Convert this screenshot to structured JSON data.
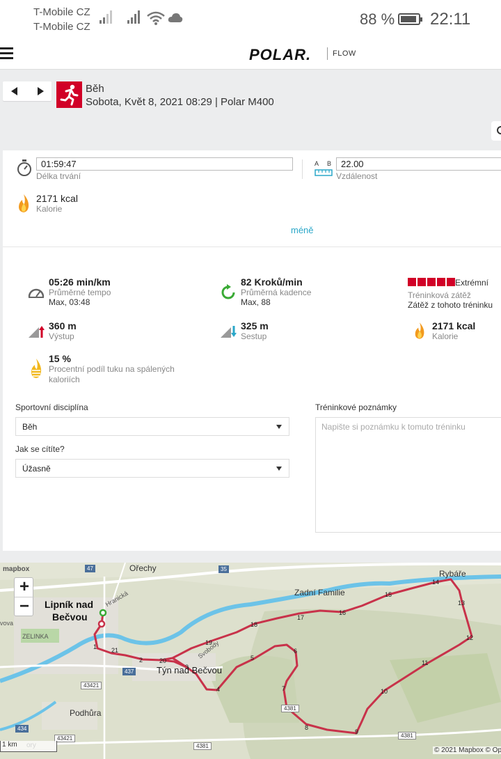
{
  "status_bar": {
    "carrier_1": "T-Mobile CZ",
    "carrier_2": "T-Mobile CZ",
    "battery": "88 %",
    "time": "22:11"
  },
  "app": {
    "brand": "POLAR.",
    "brand_sub": "FLOW"
  },
  "session": {
    "sport": "Běh",
    "details": "Sobota, Květ 8, 2021 08:29 | Polar M400",
    "sport_color": "#d10027"
  },
  "summary": {
    "duration_value": "01:59:47",
    "duration_label": "Délka trvání",
    "ab_label_a": "A",
    "ab_label_b": "B",
    "distance_value": "22.00",
    "distance_label": "Vzdálenost",
    "calories_value": "2171 kcal",
    "calories_label": "Kalorie",
    "less_link": "méně"
  },
  "stats": {
    "pace_value": "05:26 min/km",
    "pace_label": "Průměrné tempo",
    "pace_max": "Max, 03:48",
    "cadence_value": "82 Kroků/min",
    "cadence_label": "Průměrná kadence",
    "cadence_max": "Max, 88",
    "load_value": "Extrémní",
    "load_label": "Tréninková zátěž",
    "load_sub": "Zátěž z tohoto tréninku",
    "load_level": 5,
    "ascent_value": "360 m",
    "ascent_label": "Výstup",
    "descent_value": "325 m",
    "descent_label": "Sestup",
    "calories2_value": "2171 kcal",
    "calories2_label": "Kalorie",
    "fat_value": "15 %",
    "fat_label": "Procentní podíl tuku na spálených kaloriích"
  },
  "form": {
    "sport_label": "Sportovní disciplína",
    "sport_value": "Běh",
    "feeling_label": "Jak se cítíte?",
    "feeling_value": "Úžasně",
    "notes_label": "Tréninkové poznámky",
    "notes_placeholder": "Napište si poznámku k tomuto tréninku"
  },
  "map": {
    "logo": "mapbox",
    "attribution": "© 2021 Mapbox © Op",
    "scale": "1 km",
    "places": {
      "lipnik_1": "Lipník nad",
      "lipnik_2": "Bečvou",
      "orechy": "Ořechy",
      "zadni": "Zadní Familie",
      "rybare": "Rybáře",
      "tyn": "Týn nad Bečvou",
      "podhura": "Podhůra",
      "zelinka": "ZELINKA",
      "hranicka": "Hranická",
      "svobody": "Svobody",
      "vova": "vova",
      "ory": "ory"
    },
    "roads": [
      "47",
      "35",
      "437",
      "43421",
      "434",
      "43421",
      "4381",
      "4381",
      "4381"
    ],
    "route_color": "#c8324a",
    "markers": [
      "1",
      "2",
      "3",
      "4",
      "5",
      "6",
      "7",
      "8",
      "9",
      "10",
      "11",
      "12",
      "13",
      "14",
      "15",
      "16",
      "17",
      "18",
      "19",
      "20",
      "21"
    ],
    "zoom_in": "+",
    "zoom_out": "−"
  }
}
